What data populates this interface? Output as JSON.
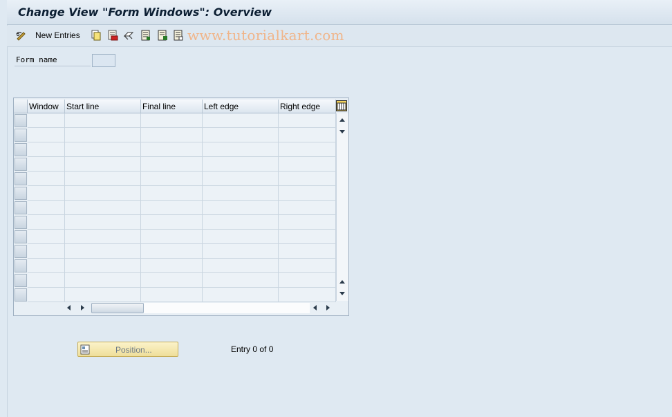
{
  "window": {
    "title": "Change View \"Form Windows\": Overview"
  },
  "toolbar": {
    "new_entries_label": "New Entries",
    "watermark": "www.tutorialkart.com",
    "icons": [
      "glasses-edit-icon",
      "copy-icon",
      "delete-icon",
      "undo-icon",
      "select-all-icon",
      "select-block-icon",
      "deselect-all-icon"
    ]
  },
  "filter": {
    "form_name_label": "Form name",
    "form_name_value": ""
  },
  "table": {
    "columns": [
      "Window",
      "Start line",
      "Final line",
      "Left edge",
      "Right edge"
    ],
    "rows": []
  },
  "footer": {
    "position_label": "Position...",
    "entry_text": "Entry 0 of 0"
  },
  "colors": {
    "background": "#dfe9f2",
    "accent_button": "#efdf9a",
    "watermark": "#f0b58a"
  }
}
